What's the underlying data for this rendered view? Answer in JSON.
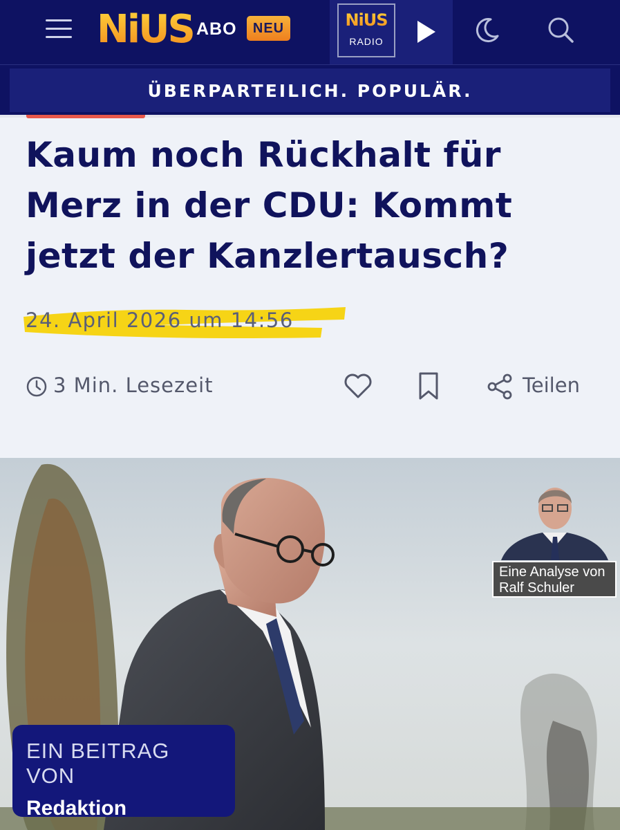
{
  "nav": {
    "logo": "NiUS",
    "abo_label": "ABO",
    "neu_badge": "NEU",
    "radio_logo_top": "NiUS",
    "radio_logo_bottom": "RADIO",
    "icons": [
      "menu-icon",
      "play-icon",
      "moon-icon",
      "search-icon"
    ]
  },
  "slogan": "ÜBERPARTEILICH. POPULÄR.",
  "article": {
    "headline": "Kaum noch Rückhalt für Merz in der CDU: Kommt jetzt der Kanzlertausch?",
    "date": "24. April 2026 um 14:56",
    "read_time": "3 Min. Lesezeit",
    "share_label": "Teilen",
    "author_caption_line1": "Eine Analyse von",
    "author_caption_line2": "Ralf Schuler",
    "byline_label": "EIN BEITRAG VON",
    "byline_name": "Redaktion"
  },
  "colors": {
    "navy": "#0e1262",
    "headline": "#10135c",
    "accent_orange": "#f28b1e",
    "highlight_yellow": "#f5d20a",
    "background": "#eff2f8"
  }
}
